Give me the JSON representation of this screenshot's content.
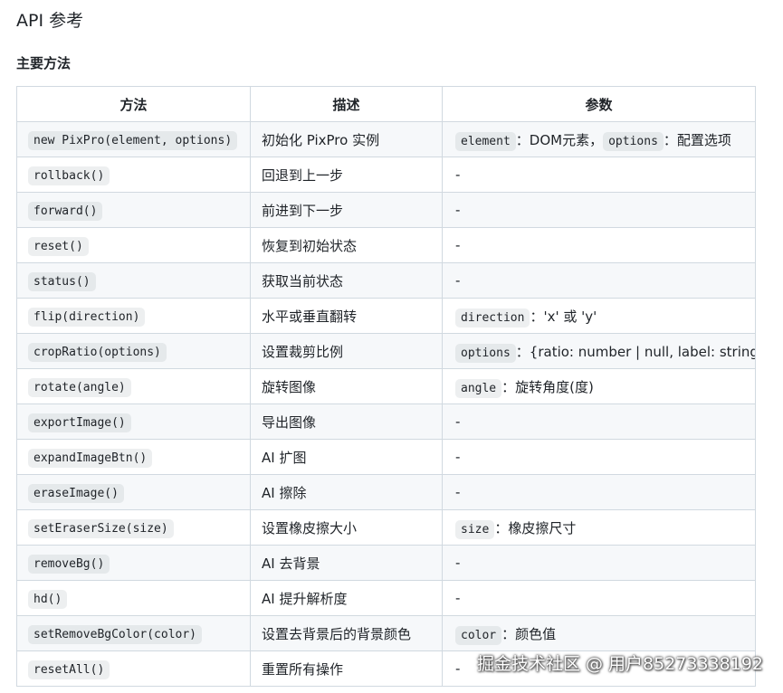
{
  "page": {
    "title": "API 参考",
    "section_title": "主要方法"
  },
  "table": {
    "headers": [
      "方法",
      "描述",
      "参数"
    ],
    "rows": [
      {
        "method": "new PixPro(element, options)",
        "desc": "初始化 PixPro 实例",
        "params": [
          {
            "code": "element",
            "text": "：DOM元素，"
          },
          {
            "code": "options",
            "text": "：配置选项"
          }
        ]
      },
      {
        "method": "rollback()",
        "desc": "回退到上一步",
        "params": [
          {
            "code": "",
            "text": "-"
          }
        ]
      },
      {
        "method": "forward()",
        "desc": "前进到下一步",
        "params": [
          {
            "code": "",
            "text": "-"
          }
        ]
      },
      {
        "method": "reset()",
        "desc": "恢复到初始状态",
        "params": [
          {
            "code": "",
            "text": "-"
          }
        ]
      },
      {
        "method": "status()",
        "desc": "获取当前状态",
        "params": [
          {
            "code": "",
            "text": "-"
          }
        ]
      },
      {
        "method": "flip(direction)",
        "desc": "水平或垂直翻转",
        "params": [
          {
            "code": "direction",
            "text": "：'x' 或 'y'"
          }
        ]
      },
      {
        "method": "cropRatio(options)",
        "desc": "设置裁剪比例",
        "params": [
          {
            "code": "options",
            "text": "：{ratio: number | null, label: string}"
          }
        ]
      },
      {
        "method": "rotate(angle)",
        "desc": "旋转图像",
        "params": [
          {
            "code": "angle",
            "text": "：旋转角度(度)"
          }
        ]
      },
      {
        "method": "exportImage()",
        "desc": "导出图像",
        "params": [
          {
            "code": "",
            "text": "-"
          }
        ]
      },
      {
        "method": "expandImageBtn()",
        "desc": "AI 扩图",
        "params": [
          {
            "code": "",
            "text": "-"
          }
        ]
      },
      {
        "method": "eraseImage()",
        "desc": "AI 擦除",
        "params": [
          {
            "code": "",
            "text": "-"
          }
        ]
      },
      {
        "method": "setEraserSize(size)",
        "desc": "设置橡皮擦大小",
        "params": [
          {
            "code": "size",
            "text": "：橡皮擦尺寸"
          }
        ]
      },
      {
        "method": "removeBg()",
        "desc": "AI 去背景",
        "params": [
          {
            "code": "",
            "text": "-"
          }
        ]
      },
      {
        "method": "hd()",
        "desc": "AI 提升解析度",
        "params": [
          {
            "code": "",
            "text": "-"
          }
        ]
      },
      {
        "method": "setRemoveBgColor(color)",
        "desc": "设置去背景后的背景颜色",
        "params": [
          {
            "code": "color",
            "text": "：颜色值"
          }
        ]
      },
      {
        "method": "resetAll()",
        "desc": "重置所有操作",
        "params": [
          {
            "code": "",
            "text": "-"
          }
        ]
      }
    ]
  },
  "watermark": {
    "text": "掘金技术社区 @ 用户85273338192"
  },
  "colors": {
    "border": "#d1d9e0",
    "stripe": "#f6f8fa",
    "text": "#1f2328"
  }
}
